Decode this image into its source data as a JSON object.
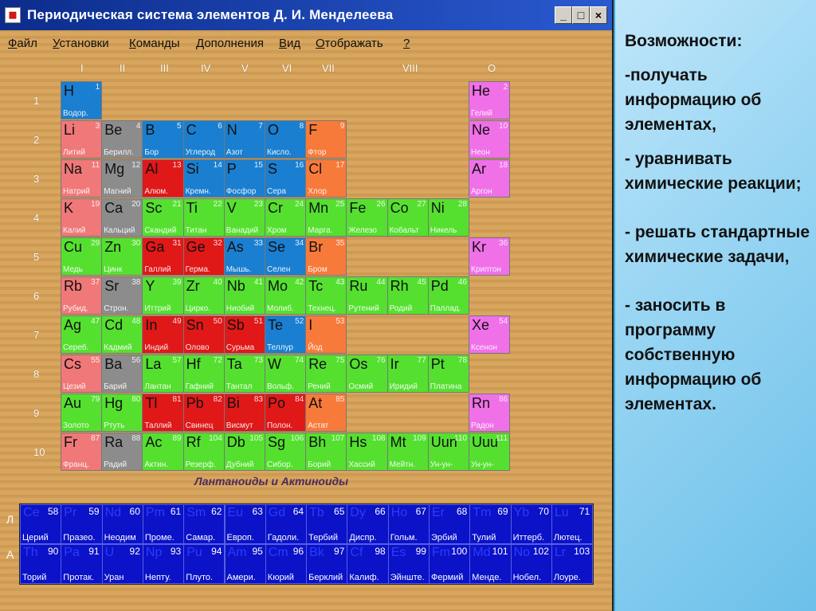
{
  "window": {
    "title": "Периодическая система элементов Д. И. Менделеева",
    "icon": "app-icon",
    "controls": [
      "_",
      "□",
      "×"
    ]
  },
  "menu": [
    {
      "label": "Файл",
      "ul": "Ф"
    },
    {
      "label": "Установки",
      "ul": "У"
    },
    {
      "label": "Команды",
      "ul": "К"
    },
    {
      "label": "Дополнения",
      "ul": "Д"
    },
    {
      "label": "Вид",
      "ul": "В"
    },
    {
      "label": "Отображать",
      "ul": "О"
    },
    {
      "label": "?",
      "ul": "?"
    }
  ],
  "colors": {
    "s": "#f07878",
    "p": "#1a7fd0",
    "d": "#55e030",
    "metal": "#e01818",
    "nonmetal": "#f87a3a",
    "noble": "#f070e8",
    "gray": "#8c8c8c",
    "f": "#0b12c8"
  },
  "groups": [
    "I",
    "II",
    "III",
    "IV",
    "V",
    "VI",
    "VII",
    "VIII",
    "O"
  ],
  "periods": [
    "1",
    "2",
    "3",
    "4",
    "5",
    "6",
    "7",
    "8",
    "9",
    "10"
  ],
  "elements": [
    {
      "s": "H",
      "n": 1,
      "name": "Водор.",
      "r": 1,
      "c": 1,
      "t": "p"
    },
    {
      "s": "He",
      "n": 2,
      "name": "Гелий",
      "r": 1,
      "c": 11,
      "t": "noble"
    },
    {
      "s": "Li",
      "n": 3,
      "name": "Литий",
      "r": 2,
      "c": 1,
      "t": "s"
    },
    {
      "s": "Be",
      "n": 4,
      "name": "Берилл.",
      "r": 2,
      "c": 2,
      "t": "gray"
    },
    {
      "s": "B",
      "n": 5,
      "name": "Бор",
      "r": 2,
      "c": 3,
      "t": "p"
    },
    {
      "s": "C",
      "n": 6,
      "name": "Углерод",
      "r": 2,
      "c": 4,
      "t": "p"
    },
    {
      "s": "N",
      "n": 7,
      "name": "Азот",
      "r": 2,
      "c": 5,
      "t": "p"
    },
    {
      "s": "O",
      "n": 8,
      "name": "Кисло.",
      "r": 2,
      "c": 6,
      "t": "p"
    },
    {
      "s": "F",
      "n": 9,
      "name": "Фтор",
      "r": 2,
      "c": 7,
      "t": "nonmetal"
    },
    {
      "s": "Ne",
      "n": 10,
      "name": "Неон",
      "r": 2,
      "c": 11,
      "t": "noble"
    },
    {
      "s": "Na",
      "n": 11,
      "name": "Натрий",
      "r": 3,
      "c": 1,
      "t": "s"
    },
    {
      "s": "Mg",
      "n": 12,
      "name": "Магний",
      "r": 3,
      "c": 2,
      "t": "gray"
    },
    {
      "s": "Al",
      "n": 13,
      "name": "Алюм.",
      "r": 3,
      "c": 3,
      "t": "metal"
    },
    {
      "s": "Si",
      "n": 14,
      "name": "Кремн.",
      "r": 3,
      "c": 4,
      "t": "p"
    },
    {
      "s": "P",
      "n": 15,
      "name": "Фосфор",
      "r": 3,
      "c": 5,
      "t": "p"
    },
    {
      "s": "S",
      "n": 16,
      "name": "Сера",
      "r": 3,
      "c": 6,
      "t": "p"
    },
    {
      "s": "Cl",
      "n": 17,
      "name": "Хлор",
      "r": 3,
      "c": 7,
      "t": "nonmetal"
    },
    {
      "s": "Ar",
      "n": 18,
      "name": "Аргон",
      "r": 3,
      "c": 11,
      "t": "noble"
    },
    {
      "s": "K",
      "n": 19,
      "name": "Калий",
      "r": 4,
      "c": 1,
      "t": "s"
    },
    {
      "s": "Ca",
      "n": 20,
      "name": "Кальций",
      "r": 4,
      "c": 2,
      "t": "gray"
    },
    {
      "s": "Sc",
      "n": 21,
      "name": "Скандий",
      "r": 4,
      "c": 3,
      "t": "d"
    },
    {
      "s": "Ti",
      "n": 22,
      "name": "Титан",
      "r": 4,
      "c": 4,
      "t": "d"
    },
    {
      "s": "V",
      "n": 23,
      "name": "Ванадий",
      "r": 4,
      "c": 5,
      "t": "d"
    },
    {
      "s": "Cr",
      "n": 24,
      "name": "Хром",
      "r": 4,
      "c": 6,
      "t": "d"
    },
    {
      "s": "Mn",
      "n": 25,
      "name": "Марга.",
      "r": 4,
      "c": 7,
      "t": "d"
    },
    {
      "s": "Fe",
      "n": 26,
      "name": "Железо",
      "r": 4,
      "c": 8,
      "t": "d"
    },
    {
      "s": "Co",
      "n": 27,
      "name": "Кобальт",
      "r": 4,
      "c": 9,
      "t": "d"
    },
    {
      "s": "Ni",
      "n": 28,
      "name": "Никель",
      "r": 4,
      "c": 10,
      "t": "d"
    },
    {
      "s": "Cu",
      "n": 29,
      "name": "Медь",
      "r": 5,
      "c": 1,
      "t": "d"
    },
    {
      "s": "Zn",
      "n": 30,
      "name": "Цинк",
      "r": 5,
      "c": 2,
      "t": "d"
    },
    {
      "s": "Ga",
      "n": 31,
      "name": "Галлий",
      "r": 5,
      "c": 3,
      "t": "metal"
    },
    {
      "s": "Ge",
      "n": 32,
      "name": "Герма.",
      "r": 5,
      "c": 4,
      "t": "metal"
    },
    {
      "s": "As",
      "n": 33,
      "name": "Мышь.",
      "r": 5,
      "c": 5,
      "t": "p"
    },
    {
      "s": "Se",
      "n": 34,
      "name": "Селен",
      "r": 5,
      "c": 6,
      "t": "p"
    },
    {
      "s": "Br",
      "n": 35,
      "name": "Бром",
      "r": 5,
      "c": 7,
      "t": "nonmetal"
    },
    {
      "s": "Kr",
      "n": 36,
      "name": "Криптон",
      "r": 5,
      "c": 11,
      "t": "noble"
    },
    {
      "s": "Rb",
      "n": 37,
      "name": "Рубид.",
      "r": 6,
      "c": 1,
      "t": "s"
    },
    {
      "s": "Sr",
      "n": 38,
      "name": "Строн.",
      "r": 6,
      "c": 2,
      "t": "gray"
    },
    {
      "s": "Y",
      "n": 39,
      "name": "Иттрий",
      "r": 6,
      "c": 3,
      "t": "d"
    },
    {
      "s": "Zr",
      "n": 40,
      "name": "Цирко.",
      "r": 6,
      "c": 4,
      "t": "d"
    },
    {
      "s": "Nb",
      "n": 41,
      "name": "Ниобий",
      "r": 6,
      "c": 5,
      "t": "d"
    },
    {
      "s": "Mo",
      "n": 42,
      "name": "Молиб.",
      "r": 6,
      "c": 6,
      "t": "d"
    },
    {
      "s": "Tc",
      "n": 43,
      "name": "Технец.",
      "r": 6,
      "c": 7,
      "t": "d"
    },
    {
      "s": "Ru",
      "n": 44,
      "name": "Рутений",
      "r": 6,
      "c": 8,
      "t": "d"
    },
    {
      "s": "Rh",
      "n": 45,
      "name": "Родий",
      "r": 6,
      "c": 9,
      "t": "d"
    },
    {
      "s": "Pd",
      "n": 46,
      "name": "Паллад.",
      "r": 6,
      "c": 10,
      "t": "d"
    },
    {
      "s": "Ag",
      "n": 47,
      "name": "Сереб.",
      "r": 7,
      "c": 1,
      "t": "d"
    },
    {
      "s": "Cd",
      "n": 48,
      "name": "Кадмий",
      "r": 7,
      "c": 2,
      "t": "d"
    },
    {
      "s": "In",
      "n": 49,
      "name": "Индий",
      "r": 7,
      "c": 3,
      "t": "metal"
    },
    {
      "s": "Sn",
      "n": 50,
      "name": "Олово",
      "r": 7,
      "c": 4,
      "t": "metal"
    },
    {
      "s": "Sb",
      "n": 51,
      "name": "Сурьма",
      "r": 7,
      "c": 5,
      "t": "metal"
    },
    {
      "s": "Te",
      "n": 52,
      "name": "Теллур",
      "r": 7,
      "c": 6,
      "t": "p"
    },
    {
      "s": "I",
      "n": 53,
      "name": "Йод",
      "r": 7,
      "c": 7,
      "t": "nonmetal"
    },
    {
      "s": "Xe",
      "n": 54,
      "name": "Ксенон",
      "r": 7,
      "c": 11,
      "t": "noble"
    },
    {
      "s": "Cs",
      "n": 55,
      "name": "Цезий",
      "r": 8,
      "c": 1,
      "t": "s"
    },
    {
      "s": "Ba",
      "n": 56,
      "name": "Барий",
      "r": 8,
      "c": 2,
      "t": "gray"
    },
    {
      "s": "La",
      "n": 57,
      "name": "Лантан",
      "r": 8,
      "c": 3,
      "t": "d"
    },
    {
      "s": "Hf",
      "n": 72,
      "name": "Гафний",
      "r": 8,
      "c": 4,
      "t": "d"
    },
    {
      "s": "Ta",
      "n": 73,
      "name": "Тантал",
      "r": 8,
      "c": 5,
      "t": "d"
    },
    {
      "s": "W",
      "n": 74,
      "name": "Вольф.",
      "r": 8,
      "c": 6,
      "t": "d"
    },
    {
      "s": "Re",
      "n": 75,
      "name": "Рений",
      "r": 8,
      "c": 7,
      "t": "d"
    },
    {
      "s": "Os",
      "n": 76,
      "name": "Осмий",
      "r": 8,
      "c": 8,
      "t": "d"
    },
    {
      "s": "Ir",
      "n": 77,
      "name": "Иридий",
      "r": 8,
      "c": 9,
      "t": "d"
    },
    {
      "s": "Pt",
      "n": 78,
      "name": "Платина",
      "r": 8,
      "c": 10,
      "t": "d"
    },
    {
      "s": "Au",
      "n": 79,
      "name": "Золото",
      "r": 9,
      "c": 1,
      "t": "d"
    },
    {
      "s": "Hg",
      "n": 80,
      "name": "Ртуть",
      "r": 9,
      "c": 2,
      "t": "d"
    },
    {
      "s": "Tl",
      "n": 81,
      "name": "Таллий",
      "r": 9,
      "c": 3,
      "t": "metal"
    },
    {
      "s": "Pb",
      "n": 82,
      "name": "Свинец",
      "r": 9,
      "c": 4,
      "t": "metal"
    },
    {
      "s": "Bi",
      "n": 83,
      "name": "Висмут",
      "r": 9,
      "c": 5,
      "t": "metal"
    },
    {
      "s": "Po",
      "n": 84,
      "name": "Полон.",
      "r": 9,
      "c": 6,
      "t": "metal"
    },
    {
      "s": "At",
      "n": 85,
      "name": "Астат",
      "r": 9,
      "c": 7,
      "t": "nonmetal"
    },
    {
      "s": "Rn",
      "n": 86,
      "name": "Радон",
      "r": 9,
      "c": 11,
      "t": "noble"
    },
    {
      "s": "Fr",
      "n": 87,
      "name": "Франц.",
      "r": 10,
      "c": 1,
      "t": "s"
    },
    {
      "s": "Ra",
      "n": 88,
      "name": "Радий",
      "r": 10,
      "c": 2,
      "t": "gray"
    },
    {
      "s": "Ac",
      "n": 89,
      "name": "Актин.",
      "r": 10,
      "c": 3,
      "t": "d"
    },
    {
      "s": "Rf",
      "n": 104,
      "name": "Резерф.",
      "r": 10,
      "c": 4,
      "t": "d"
    },
    {
      "s": "Db",
      "n": 105,
      "name": "Дубний",
      "r": 10,
      "c": 5,
      "t": "d"
    },
    {
      "s": "Sg",
      "n": 106,
      "name": "Сибор.",
      "r": 10,
      "c": 6,
      "t": "d"
    },
    {
      "s": "Bh",
      "n": 107,
      "name": "Борий",
      "r": 10,
      "c": 7,
      "t": "d"
    },
    {
      "s": "Hs",
      "n": 108,
      "name": "Хассий",
      "r": 10,
      "c": 8,
      "t": "d"
    },
    {
      "s": "Mt",
      "n": 109,
      "name": "Мейтн.",
      "r": 10,
      "c": 9,
      "t": "d"
    },
    {
      "s": "Uun",
      "n": 110,
      "name": "Ун-ун-",
      "r": 10,
      "c": 10,
      "t": "d"
    },
    {
      "s": "Uuu",
      "n": 111,
      "name": "Ун-ун-",
      "r": 10,
      "c": 11,
      "t": "d"
    }
  ],
  "f_caption": "Лантаноиды и Актиноиды",
  "f_rows": [
    "Л",
    "А"
  ],
  "f_elements": [
    {
      "s": "Ce",
      "n": 58,
      "name": "Церий",
      "row": 0,
      "c": 0
    },
    {
      "s": "Pr",
      "n": 59,
      "name": "Празео.",
      "row": 0,
      "c": 1
    },
    {
      "s": "Nd",
      "n": 60,
      "name": "Неодим",
      "row": 0,
      "c": 2
    },
    {
      "s": "Pm",
      "n": 61,
      "name": "Проме.",
      "row": 0,
      "c": 3
    },
    {
      "s": "Sm",
      "n": 62,
      "name": "Самар.",
      "row": 0,
      "c": 4
    },
    {
      "s": "Eu",
      "n": 63,
      "name": "Европ.",
      "row": 0,
      "c": 5
    },
    {
      "s": "Gd",
      "n": 64,
      "name": "Гадоли.",
      "row": 0,
      "c": 6
    },
    {
      "s": "Tb",
      "n": 65,
      "name": "Тербий",
      "row": 0,
      "c": 7
    },
    {
      "s": "Dy",
      "n": 66,
      "name": "Диспр.",
      "row": 0,
      "c": 8
    },
    {
      "s": "Ho",
      "n": 67,
      "name": "Гольм.",
      "row": 0,
      "c": 9
    },
    {
      "s": "Er",
      "n": 68,
      "name": "Эрбий",
      "row": 0,
      "c": 10
    },
    {
      "s": "Tm",
      "n": 69,
      "name": "Тулий",
      "row": 0,
      "c": 11
    },
    {
      "s": "Yb",
      "n": 70,
      "name": "Иттерб.",
      "row": 0,
      "c": 12
    },
    {
      "s": "Lu",
      "n": 71,
      "name": "Лютец.",
      "row": 0,
      "c": 13
    },
    {
      "s": "Th",
      "n": 90,
      "name": "Торий",
      "row": 1,
      "c": 0
    },
    {
      "s": "Pa",
      "n": 91,
      "name": "Протак.",
      "row": 1,
      "c": 1
    },
    {
      "s": "U",
      "n": 92,
      "name": "Уран",
      "row": 1,
      "c": 2
    },
    {
      "s": "Np",
      "n": 93,
      "name": "Непту.",
      "row": 1,
      "c": 3
    },
    {
      "s": "Pu",
      "n": 94,
      "name": "Плуто.",
      "row": 1,
      "c": 4
    },
    {
      "s": "Am",
      "n": 95,
      "name": "Амери.",
      "row": 1,
      "c": 5
    },
    {
      "s": "Cm",
      "n": 96,
      "name": "Кюрий",
      "row": 1,
      "c": 6
    },
    {
      "s": "Bk",
      "n": 97,
      "name": "Берклий",
      "row": 1,
      "c": 7
    },
    {
      "s": "Cf",
      "n": 98,
      "name": "Калиф.",
      "row": 1,
      "c": 8
    },
    {
      "s": "Es",
      "n": 99,
      "name": "Эйнште.",
      "row": 1,
      "c": 9
    },
    {
      "s": "Fm",
      "n": 100,
      "name": "Фермий",
      "row": 1,
      "c": 10
    },
    {
      "s": "Md",
      "n": 101,
      "name": "Менде.",
      "row": 1,
      "c": 11
    },
    {
      "s": "No",
      "n": 102,
      "name": "Нобел.",
      "row": 1,
      "c": 12
    },
    {
      "s": "Lr",
      "n": 103,
      "name": "Лоуре.",
      "row": 1,
      "c": 13
    }
  ],
  "side": {
    "heading": "Возможности:",
    "items": [
      "-получать информацию об элементах,",
      "- уравнивать химические реакции;",
      "-  решать стандартные химические задачи,",
      "- заносить в программу собственную информацию об элементах."
    ]
  }
}
